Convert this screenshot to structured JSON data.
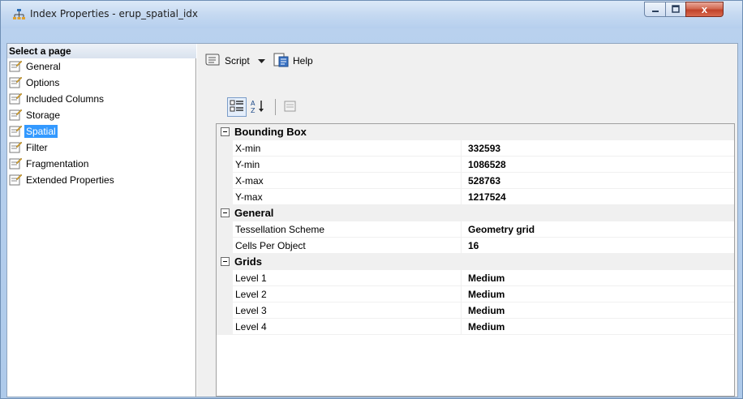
{
  "window": {
    "title": "Index Properties - erup_spatial_idx",
    "close_glyph": "x"
  },
  "nav": {
    "header": "Select a page",
    "items": [
      {
        "label": "General",
        "selected": false
      },
      {
        "label": "Options",
        "selected": false
      },
      {
        "label": "Included Columns",
        "selected": false
      },
      {
        "label": "Storage",
        "selected": false
      },
      {
        "label": "Spatial",
        "selected": true
      },
      {
        "label": "Filter",
        "selected": false
      },
      {
        "label": "Fragmentation",
        "selected": false
      },
      {
        "label": "Extended Properties",
        "selected": false
      }
    ]
  },
  "toolbar": {
    "script_label": "Script",
    "help_label": "Help"
  },
  "grid": {
    "categories": [
      {
        "name": "Bounding Box",
        "props": [
          {
            "name": "X-min",
            "value": "332593"
          },
          {
            "name": "Y-min",
            "value": "1086528"
          },
          {
            "name": "X-max",
            "value": "528763"
          },
          {
            "name": "Y-max",
            "value": "1217524"
          }
        ]
      },
      {
        "name": "General",
        "props": [
          {
            "name": "Tessellation Scheme",
            "value": "Geometry grid"
          },
          {
            "name": "Cells Per Object",
            "value": "16"
          }
        ]
      },
      {
        "name": "Grids",
        "props": [
          {
            "name": "Level 1",
            "value": "Medium"
          },
          {
            "name": "Level 2",
            "value": "Medium"
          },
          {
            "name": "Level 3",
            "value": "Medium"
          },
          {
            "name": "Level 4",
            "value": "Medium"
          }
        ]
      }
    ]
  },
  "colors": {
    "selection": "#3399ff",
    "close_button": "#c0432a"
  }
}
